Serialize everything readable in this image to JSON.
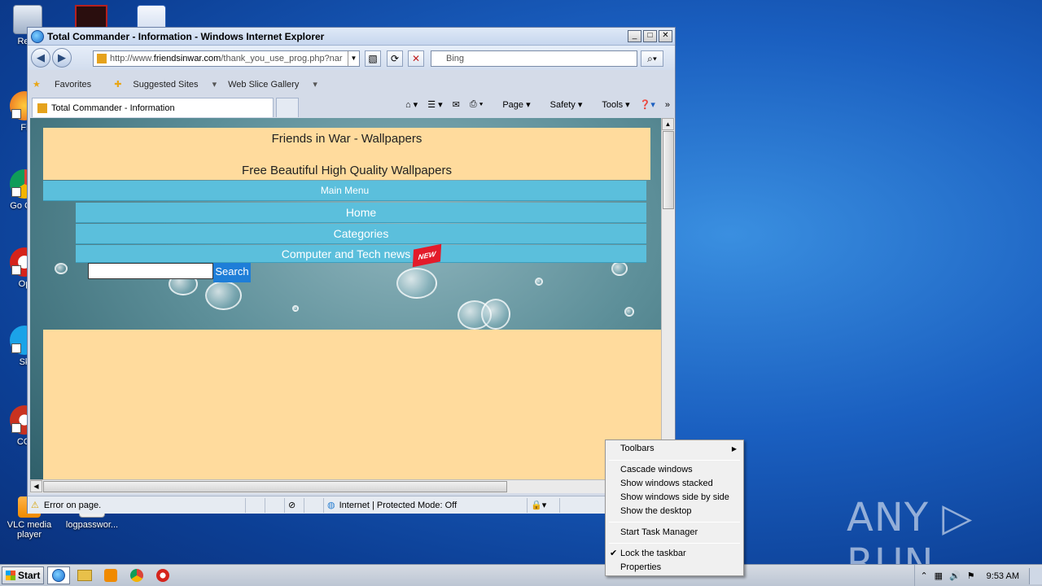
{
  "desktop": {
    "icons": [
      {
        "label": "Recy",
        "color": "#c9d6e8"
      },
      {
        "label": "",
        "color": "#b52020"
      },
      {
        "label": "",
        "color": "#2b5fb5"
      },
      {
        "label": "Fi",
        "color": "#e8651b"
      },
      {
        "label": "Go Chr",
        "color": "#2ea84f"
      },
      {
        "label": "Op",
        "color": "#d5231b"
      },
      {
        "label": "Sk",
        "color": "#1ba3e8"
      },
      {
        "label": "CCl",
        "color": "#c93220"
      },
      {
        "label": "VLC media player",
        "color": "#f08a00"
      },
      {
        "label": "logpasswor...",
        "color": "#e8e8e8"
      }
    ]
  },
  "ie": {
    "title": "Total Commander - Information - Windows Internet Explorer",
    "window_buttons": {
      "minimize": "_",
      "maximize": "□",
      "close": "✕"
    },
    "address": {
      "prefix": "http://www.",
      "domain": "friendsinwar.com",
      "path": "/thank_you_use_prog.php?nar"
    },
    "search_placeholder": "Bing",
    "favorites": {
      "label": "Favorites",
      "suggested": "Suggested Sites",
      "webslice": "Web Slice Gallery"
    },
    "tab_title": "Total Commander - Information",
    "commands": {
      "page": "Page",
      "safety": "Safety",
      "tools": "Tools"
    },
    "status": {
      "error": "Error on page.",
      "zone": "Internet | Protected Mode: Off"
    }
  },
  "site": {
    "title": "Friends in War - Wallpapers",
    "subtitle": "Free Beautiful High Quality Wallpapers",
    "main_menu": "Main Menu",
    "menu": [
      "Home",
      "Categories",
      "Computer and Tech news"
    ],
    "new_badge": "NEW",
    "search_button": "Search"
  },
  "context_menu": {
    "items": [
      "Toolbars",
      "Cascade windows",
      "Show windows stacked",
      "Show windows side by side",
      "Show the desktop",
      "Start Task Manager",
      "Lock the taskbar",
      "Properties"
    ]
  },
  "taskbar": {
    "start": "Start",
    "clock": "9:53 AM"
  },
  "watermark": "ANY ▷ RUN"
}
